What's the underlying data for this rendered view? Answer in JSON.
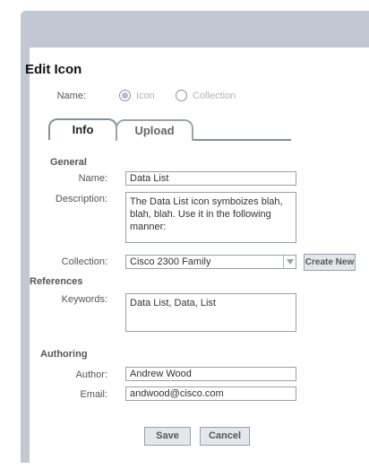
{
  "title": "Edit Icon",
  "name_row": {
    "label": "Name:",
    "options": [
      "Icon",
      "Collection"
    ],
    "selected": "Icon"
  },
  "tabs": [
    {
      "label": "Info",
      "active": true
    },
    {
      "label": "Upload",
      "active": false
    }
  ],
  "general": {
    "heading": "General",
    "name_label": "Name:",
    "name_value": "Data List",
    "description_label": "Description:",
    "description_value": "The Data List icon symboizes blah, blah, blah. Use it in the following manner:",
    "collection_label": "Collection:",
    "collection_value": "Cisco 2300 Family",
    "create_new_label": "Create New"
  },
  "references": {
    "heading": "References",
    "keywords_label": "Keywords:",
    "keywords_value": "Data List, Data, List"
  },
  "authoring": {
    "heading": "Authoring",
    "author_label": "Author:",
    "author_value": "Andrew Wood",
    "email_label": "Email:",
    "email_value": "andwood@cisco.com"
  },
  "actions": {
    "save_label": "Save",
    "cancel_label": "Cancel"
  },
  "colors": {
    "window_frame": "#c2c7d2",
    "tab_border": "#8a8f97"
  }
}
